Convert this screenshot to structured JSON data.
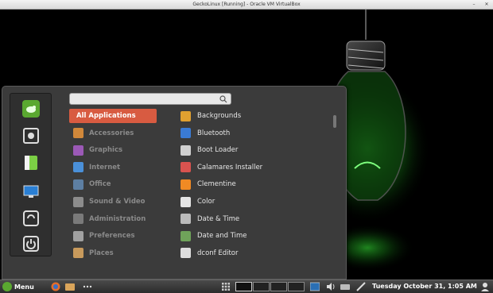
{
  "vm_window": {
    "title": "GeckoLinux [Running] - Oracle VM VirtualBox"
  },
  "menu": {
    "favorites": [
      {
        "name": "gecko-logo-icon"
      },
      {
        "name": "software-manager-icon"
      },
      {
        "name": "notes-icon"
      },
      {
        "name": "display-settings-icon"
      },
      {
        "name": "logout-icon"
      },
      {
        "name": "power-icon"
      }
    ],
    "search": {
      "value": "",
      "placeholder": ""
    },
    "categories": [
      {
        "label": "All Applications",
        "icon": "apps-icon",
        "color": "#d85b41"
      },
      {
        "label": "Accessories",
        "icon": "accessories-icon",
        "color": "#d1883a"
      },
      {
        "label": "Graphics",
        "icon": "graphics-icon",
        "color": "#9b59b6"
      },
      {
        "label": "Internet",
        "icon": "internet-icon",
        "color": "#4a90d9"
      },
      {
        "label": "Office",
        "icon": "office-icon",
        "color": "#5d7fa3"
      },
      {
        "label": "Sound & Video",
        "icon": "sound-video-icon",
        "color": "#8c8c8c"
      },
      {
        "label": "Administration",
        "icon": "administration-icon",
        "color": "#7a7a7a"
      },
      {
        "label": "Preferences",
        "icon": "preferences-icon",
        "color": "#a0a0a0"
      },
      {
        "label": "Places",
        "icon": "folder-icon",
        "color": "#c89a5c"
      }
    ],
    "apps": [
      {
        "label": "Backgrounds",
        "icon": "backgrounds-icon",
        "color": "#e0a030"
      },
      {
        "label": "Bluetooth",
        "icon": "bluetooth-icon",
        "color": "#3a7bd5"
      },
      {
        "label": "Boot Loader",
        "icon": "boot-loader-icon",
        "color": "#cfcfcf"
      },
      {
        "label": "Calamares Installer",
        "icon": "installer-icon",
        "color": "#d9534f"
      },
      {
        "label": "Clementine",
        "icon": "clementine-icon",
        "color": "#f08a24"
      },
      {
        "label": "Color",
        "icon": "color-icon",
        "color": "#e5e5e5"
      },
      {
        "label": "Date & Time",
        "icon": "clock-icon",
        "color": "#bbbbbb"
      },
      {
        "label": "Date and Time",
        "icon": "date-time-icon",
        "color": "#6fa35a"
      },
      {
        "label": "dconf Editor",
        "icon": "dconf-icon",
        "color": "#dddddd"
      }
    ]
  },
  "panel": {
    "menu_label": "Menu",
    "clock": "Tuesday October 31,  1:05 AM"
  },
  "colors": {
    "accent": "#d85b41",
    "bulb_glow": "#2ecc2e"
  }
}
